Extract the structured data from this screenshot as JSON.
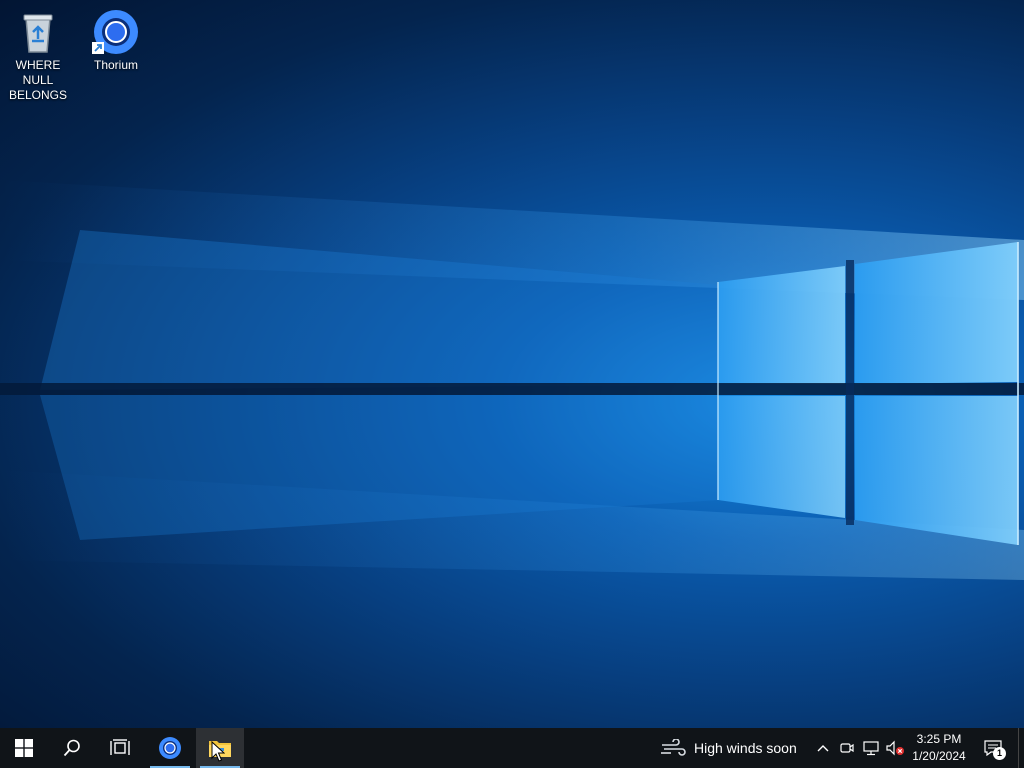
{
  "desktop": {
    "icons": [
      {
        "label": "WHERE NULL BELONGS",
        "icon": "recycle-bin-icon"
      },
      {
        "label": "Thorium",
        "icon": "thorium-browser-icon"
      }
    ]
  },
  "taskbar": {
    "start": {
      "icon": "windows-logo-icon"
    },
    "search": {
      "icon": "search-icon"
    },
    "task_view": {
      "icon": "task-view-icon"
    },
    "pinned_apps": [
      {
        "name": "Thorium",
        "icon": "thorium-browser-icon",
        "running": true
      },
      {
        "name": "File Explorer",
        "icon": "folder-icon",
        "running": true,
        "active": true
      }
    ],
    "weather": {
      "icon": "wind-icon",
      "text": "High winds soon"
    },
    "tray": {
      "chevron_icon": "chevron-up-icon",
      "icons": [
        "meet-now-icon",
        "network-icon",
        "volume-muted-icon"
      ]
    },
    "clock": {
      "time": "3:25 PM",
      "date": "1/20/2024"
    },
    "notifications": {
      "count": "1",
      "icon": "notification-icon"
    }
  },
  "colors": {
    "taskbar_bg": "#101418",
    "accent": "#76b9ed",
    "wallpaper_light": "#8fd2ff",
    "wallpaper_dark": "#021533"
  }
}
